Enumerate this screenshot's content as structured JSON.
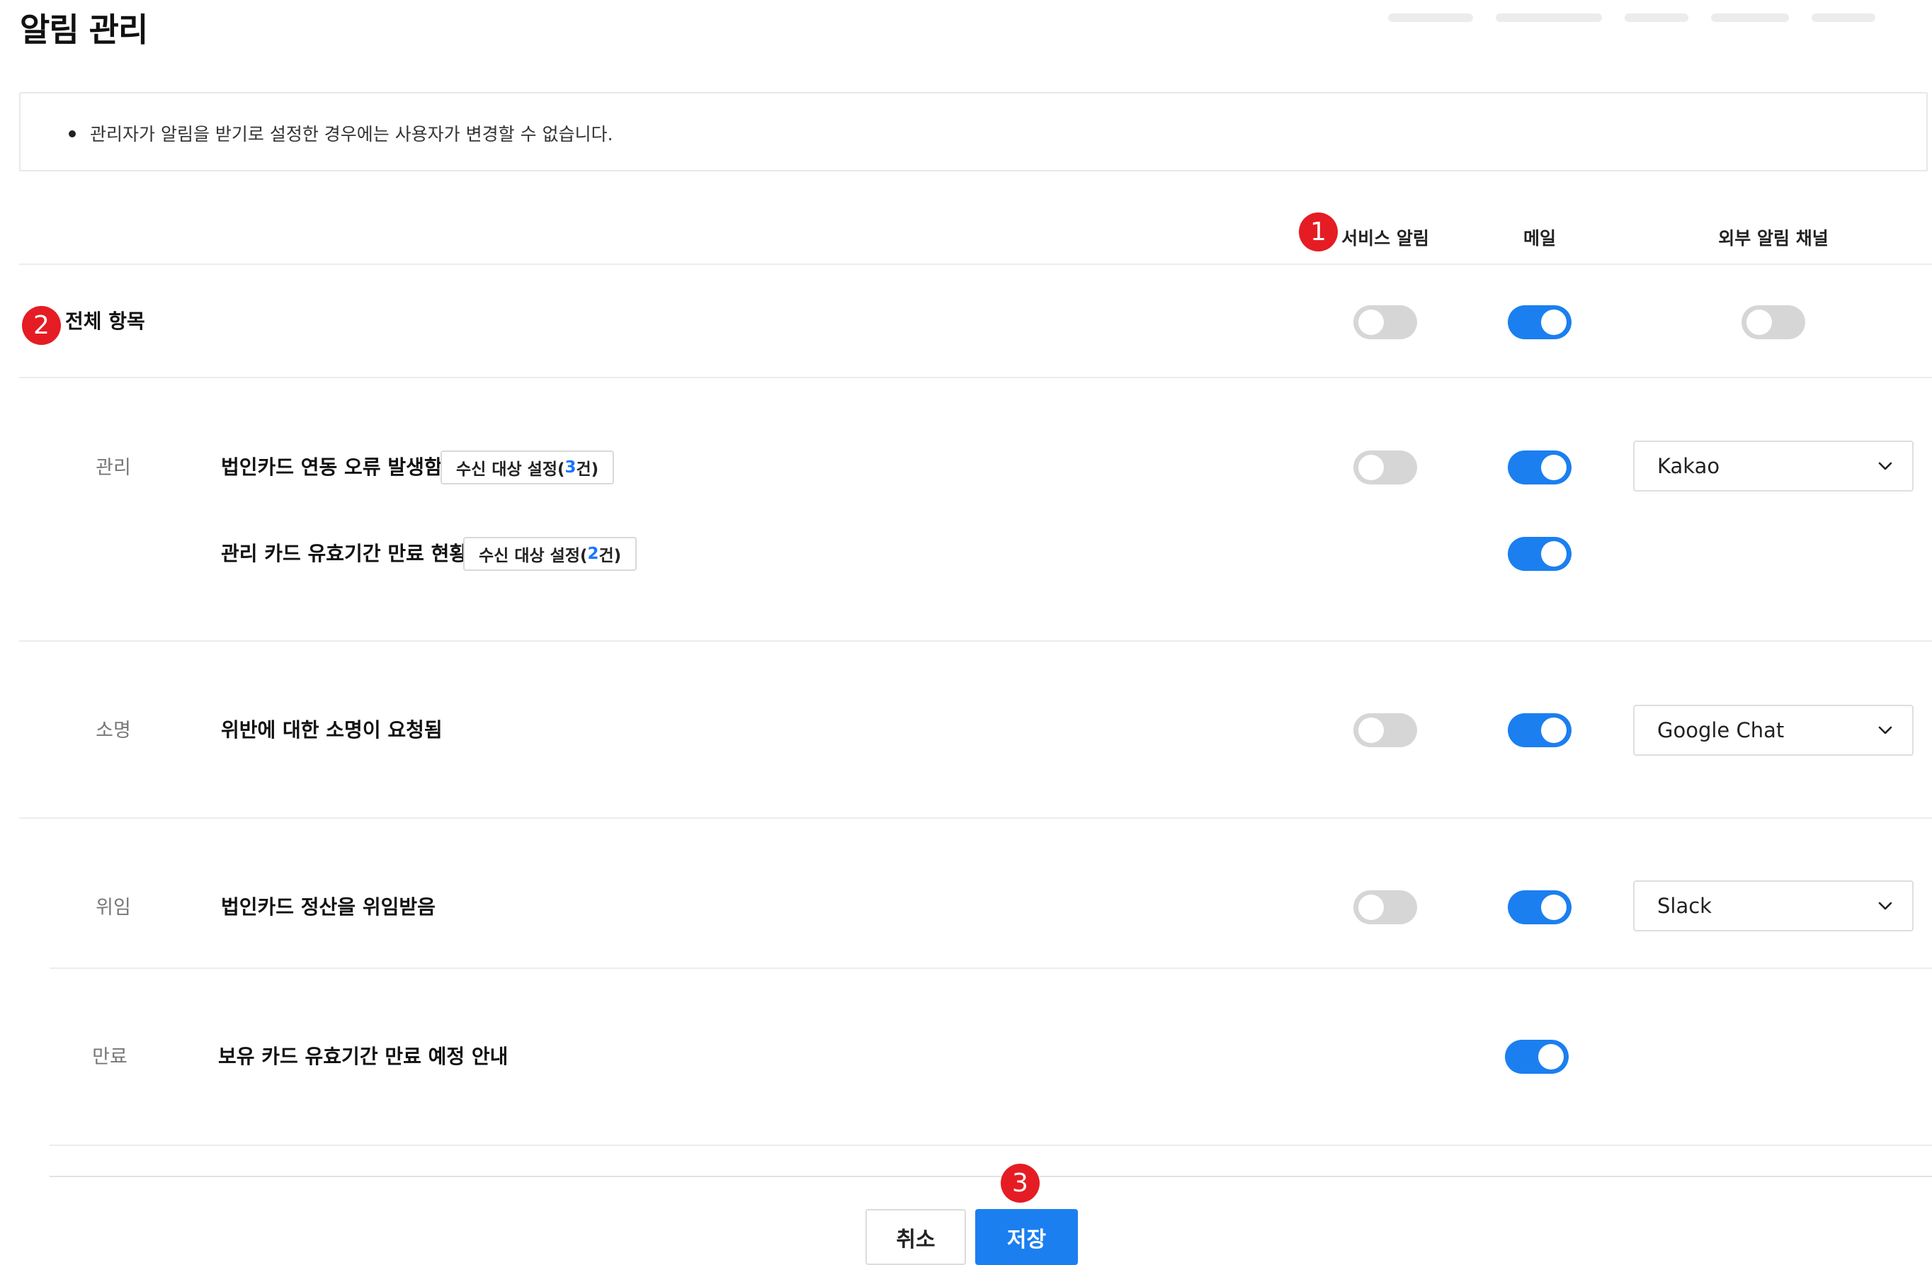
{
  "page": {
    "title": "알림 관리"
  },
  "notice": {
    "text": "관리자가 알림을 받기로 설정한 경우에는 사용자가 변경할 수 없습니다."
  },
  "columns": {
    "service": "서비스 알림",
    "mail": "메일",
    "external": "외부 알림 채널"
  },
  "all_items": {
    "label": "전체 항목",
    "service_on": false,
    "mail_on": true,
    "external_on": false
  },
  "sections": [
    {
      "category": "관리",
      "items": [
        {
          "label": "법인카드 연동 오류 발생함",
          "recipients": {
            "prefix": "수신 대상 설정(",
            "count": "3",
            "suffix": "건)"
          },
          "service_on": false,
          "mail_on": true,
          "channel": "Kakao"
        },
        {
          "label": "관리 카드 유효기간 만료 현황",
          "recipients": {
            "prefix": "수신 대상 설정(",
            "count": "2",
            "suffix": "건)"
          },
          "mail_on": true
        }
      ]
    },
    {
      "category": "소명",
      "items": [
        {
          "label": "위반에 대한 소명이 요청됨",
          "service_on": false,
          "mail_on": true,
          "channel": "Google Chat"
        }
      ]
    },
    {
      "category": "위임",
      "items": [
        {
          "label": "법인카드 정산을 위임받음",
          "service_on": false,
          "mail_on": true,
          "channel": "Slack"
        }
      ]
    },
    {
      "category": "만료",
      "items": [
        {
          "label": "보유 카드 유효기간 만료 예정 안내",
          "mail_on": true
        }
      ]
    }
  ],
  "annotations": [
    "1",
    "2",
    "3"
  ],
  "buttons": {
    "cancel": "취소",
    "save": "저장"
  },
  "colors": {
    "accent": "#1b7ff0",
    "toggle_off": "#d6d6d6",
    "annotation": "#e51c23"
  },
  "icons": {
    "select_arrow": "chevron-down-icon"
  }
}
